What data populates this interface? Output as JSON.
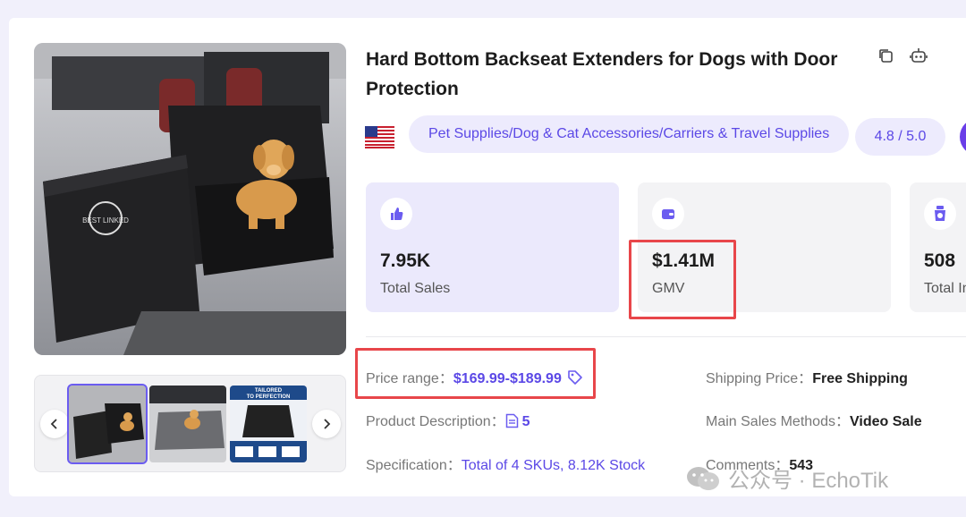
{
  "product": {
    "title": "Hard Bottom Backseat Extenders for Dogs with Door Protection",
    "category": "Pet Supplies/Dog & Cat Accessories/Carriers & Travel Supplies",
    "rating": "4.8 / 5.0",
    "main_image_logo_text": "BEST LINKED"
  },
  "thumbnails": {
    "third_caption_line1": "TAILORED",
    "third_caption_line2": "TO PERFECTION"
  },
  "stats": [
    {
      "value": "7.95K",
      "label": "Total Sales",
      "icon": "thumbs-up-icon"
    },
    {
      "value": "$1.41M",
      "label": "GMV",
      "icon": "wallet-icon"
    },
    {
      "value": "508",
      "label": "Total In",
      "icon": "box-icon"
    }
  ],
  "details": {
    "price_range_label": "Price range",
    "price_range_value": "$169.99-$189.99",
    "shipping_label": "Shipping Price",
    "shipping_value": "Free Shipping",
    "description_label": "Product Description",
    "description_value": "5",
    "sales_method_label": "Main Sales Methods",
    "sales_method_value": "Video Sale",
    "spec_label": "Specification",
    "spec_value": "Total of 4 SKUs, 8.12K Stock",
    "comments_label": "Comments",
    "comments_value": "543"
  },
  "watermark": {
    "text": "公众号 · EchoTik"
  },
  "colors": {
    "accent": "#5b48e6",
    "highlight": "#e8464a",
    "pill_bg": "#edebfd"
  }
}
